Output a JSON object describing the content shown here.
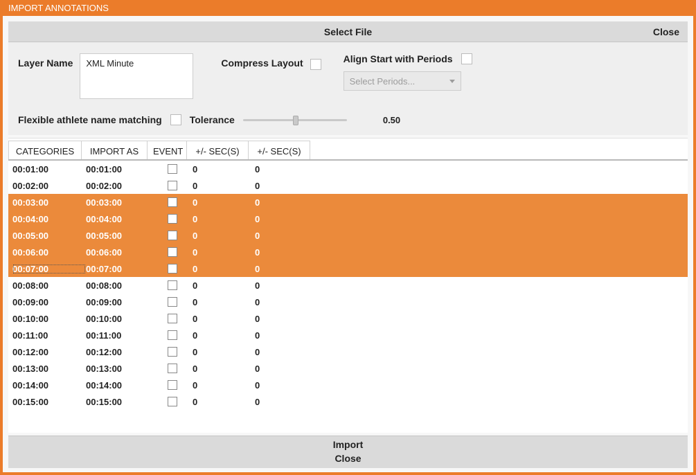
{
  "titlebar": "IMPORT ANNOTATIONS",
  "top": {
    "select_file": "Select File",
    "close": "Close"
  },
  "opts": {
    "layer_name_label": "Layer Name",
    "layer_name_value": "XML Minute",
    "compress_label": "Compress Layout",
    "align_label": "Align Start with Periods",
    "select_periods_placeholder": "Select Periods...",
    "flex_label": "Flexible athlete name matching",
    "tol_label": "Tolerance",
    "tol_value": "0.50"
  },
  "headers": {
    "categories": "CATEGORIES",
    "import_as": "IMPORT AS",
    "event": "EVENT",
    "sec1": "+/- SEC(S)",
    "sec2": "+/- SEC(S)"
  },
  "rows": [
    {
      "cat": "00:01:00",
      "imp": "00:01:00",
      "s1": "0",
      "s2": "0",
      "sel": false
    },
    {
      "cat": "00:02:00",
      "imp": "00:02:00",
      "s1": "0",
      "s2": "0",
      "sel": false
    },
    {
      "cat": "00:03:00",
      "imp": "00:03:00",
      "s1": "0",
      "s2": "0",
      "sel": true
    },
    {
      "cat": "00:04:00",
      "imp": "00:04:00",
      "s1": "0",
      "s2": "0",
      "sel": true
    },
    {
      "cat": "00:05:00",
      "imp": "00:05:00",
      "s1": "0",
      "s2": "0",
      "sel": true
    },
    {
      "cat": "00:06:00",
      "imp": "00:06:00",
      "s1": "0",
      "s2": "0",
      "sel": true
    },
    {
      "cat": "00:07:00",
      "imp": "00:07:00",
      "s1": "0",
      "s2": "0",
      "sel": true,
      "focus": true
    },
    {
      "cat": "00:08:00",
      "imp": "00:08:00",
      "s1": "0",
      "s2": "0",
      "sel": false
    },
    {
      "cat": "00:09:00",
      "imp": "00:09:00",
      "s1": "0",
      "s2": "0",
      "sel": false
    },
    {
      "cat": "00:10:00",
      "imp": "00:10:00",
      "s1": "0",
      "s2": "0",
      "sel": false
    },
    {
      "cat": "00:11:00",
      "imp": "00:11:00",
      "s1": "0",
      "s2": "0",
      "sel": false
    },
    {
      "cat": "00:12:00",
      "imp": "00:12:00",
      "s1": "0",
      "s2": "0",
      "sel": false
    },
    {
      "cat": "00:13:00",
      "imp": "00:13:00",
      "s1": "0",
      "s2": "0",
      "sel": false
    },
    {
      "cat": "00:14:00",
      "imp": "00:14:00",
      "s1": "0",
      "s2": "0",
      "sel": false
    },
    {
      "cat": "00:15:00",
      "imp": "00:15:00",
      "s1": "0",
      "s2": "0",
      "sel": false
    }
  ],
  "bottom": {
    "import": "Import",
    "close": "Close"
  }
}
